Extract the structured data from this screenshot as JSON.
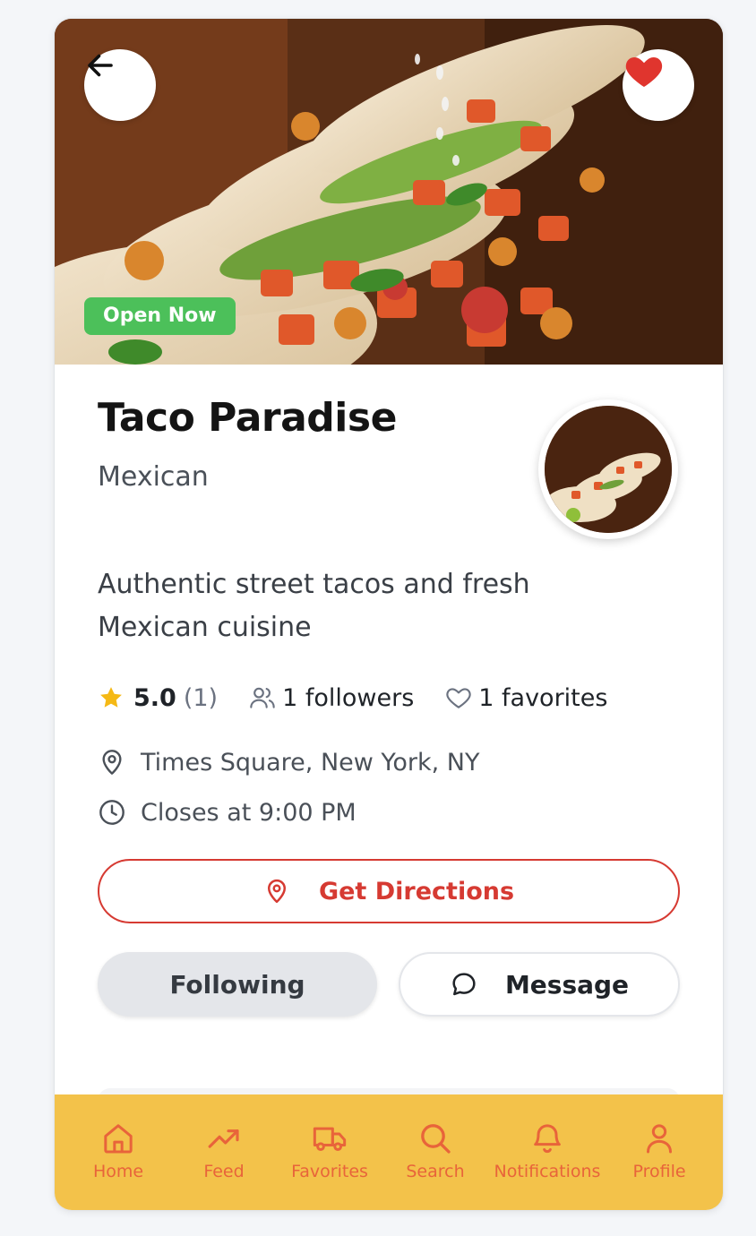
{
  "restaurant": {
    "status_badge": "Open Now",
    "name": "Taco Paradise",
    "cuisine": "Mexican",
    "description": "Authentic street tacos and fresh Mexican cuisine",
    "rating": "5.0",
    "rating_count": "(1)",
    "followers": "1 followers",
    "favorites": "1 favorites",
    "location": "Times Square, New York, NY",
    "hours": "Closes at 9:00 PM",
    "is_favorited": true
  },
  "actions": {
    "directions_label": "Get Directions",
    "following_label": "Following",
    "message_label": "Message"
  },
  "colors": {
    "accent_red": "#d63a32",
    "open_green": "#4cc05a",
    "nav_yellow": "#f3c24a",
    "nav_orange": "#e8643a",
    "star_gold": "#f5b915"
  },
  "icons": {
    "back": "arrow-left-icon",
    "favorite": "heart-icon",
    "star": "star-icon",
    "followers": "users-icon",
    "favorites": "heart-outline-icon",
    "location": "map-pin-icon",
    "hours": "clock-icon",
    "message": "chat-bubble-icon"
  },
  "bottom_nav": {
    "items": [
      {
        "label": "Home",
        "icon": "home-icon"
      },
      {
        "label": "Feed",
        "icon": "trending-up-icon"
      },
      {
        "label": "Favorites",
        "icon": "truck-icon"
      },
      {
        "label": "Search",
        "icon": "search-icon"
      },
      {
        "label": "Notifications",
        "icon": "bell-icon"
      },
      {
        "label": "Profile",
        "icon": "user-icon"
      }
    ]
  }
}
